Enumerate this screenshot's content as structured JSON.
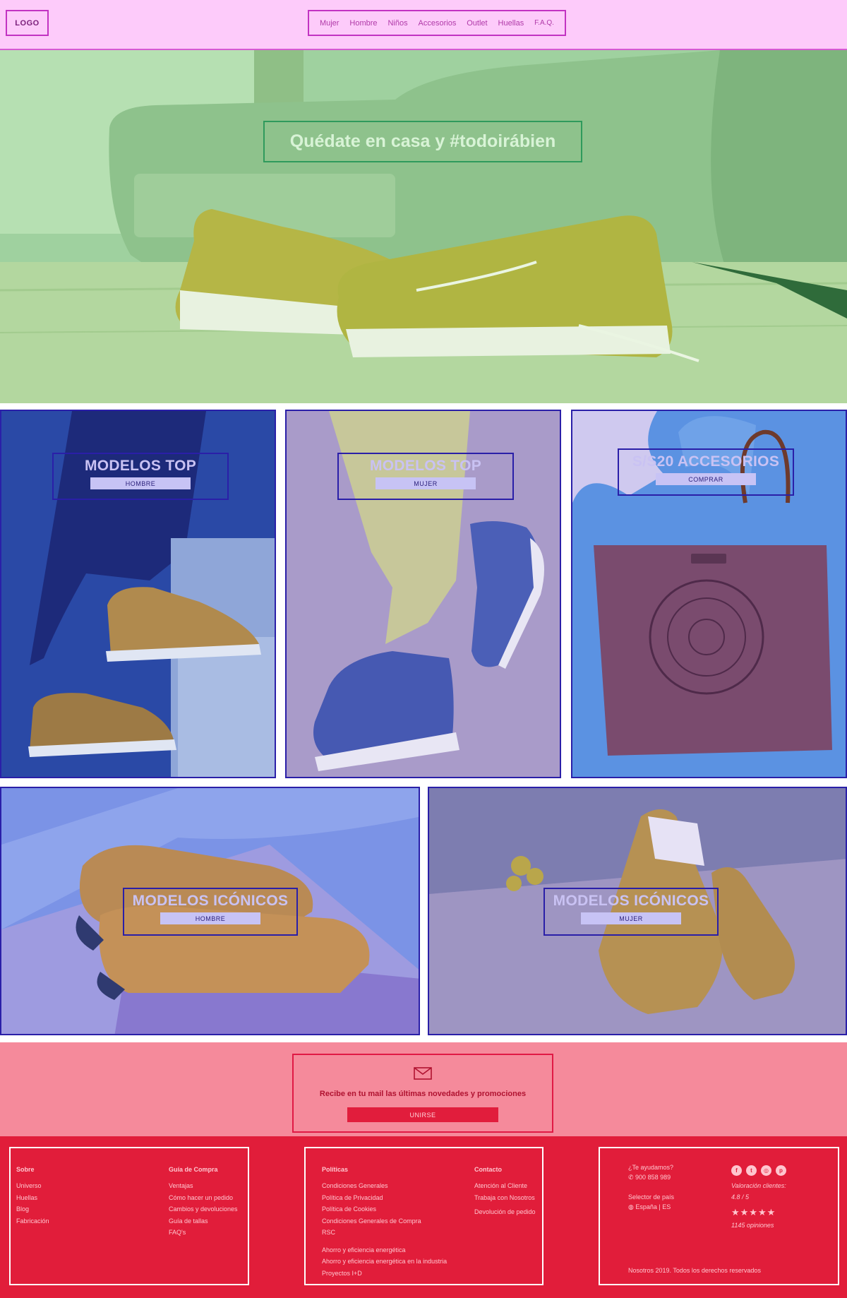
{
  "header": {
    "logo": "LOGO",
    "nav": [
      "Mujer",
      "Hombre",
      "Niños",
      "Accesorios",
      "Outlet",
      "Huellas",
      "F.A.Q."
    ]
  },
  "hero": {
    "title": "Quédate en casa y #todoirábien"
  },
  "tiles": [
    {
      "title": "MODELOS TOP",
      "button": "HOMBRE"
    },
    {
      "title": "MODELOS TOP",
      "button": "MUJER"
    },
    {
      "title": "S/S20 ACCESORIOS",
      "button": "COMPRAR"
    },
    {
      "title": "MODELOS ICÓNICOS",
      "button": "HOMBRE"
    },
    {
      "title": "MODELOS ICÓNICOS",
      "button": "MUJER"
    }
  ],
  "newsletter": {
    "icon": "mail-icon",
    "text": "Recibe en tu mail las últimas novedades y promociones",
    "button": "UNIRSE"
  },
  "footer": {
    "sobre": {
      "heading": "Sobre",
      "items": [
        "Universo",
        "Huellas",
        "Blog",
        "Fabricación"
      ]
    },
    "guia": {
      "heading": "Guía de Compra",
      "items": [
        "Ventajas",
        "Cómo hacer un pedido",
        "Cambios y devoluciones",
        "Guía de tallas",
        "FAQ's"
      ]
    },
    "politicas": {
      "heading": "Políticas",
      "items": [
        "Condiciones Generales",
        "Política de Privacidad",
        "Política de Cookies",
        "Condiciones Generales de Compra",
        "RSC"
      ],
      "items2": [
        "Ahorro y eficiencia energética",
        "Ahorro y eficiencia energética en la industria",
        "Proyectos I+D"
      ]
    },
    "contacto": {
      "heading": "Contacto",
      "items": [
        "Atención al Cliente",
        "Trabaja con Nosotros"
      ],
      "item_last": "Devolución de pedido"
    },
    "help": {
      "label": "¿Te ayudamos?",
      "phone": "900 858 989"
    },
    "country": {
      "label": "Selector de país",
      "value": "España | ES"
    },
    "rating": {
      "label": "Valoración clientes:",
      "score": "4.8 / 5",
      "stars": "★★★★★",
      "count": "1145 opiniones"
    },
    "social_icons": [
      "facebook-icon",
      "twitter-icon",
      "instagram-icon",
      "pinterest-icon"
    ],
    "copyright": "Nosotros 2019. Todos los derechos reservados"
  }
}
